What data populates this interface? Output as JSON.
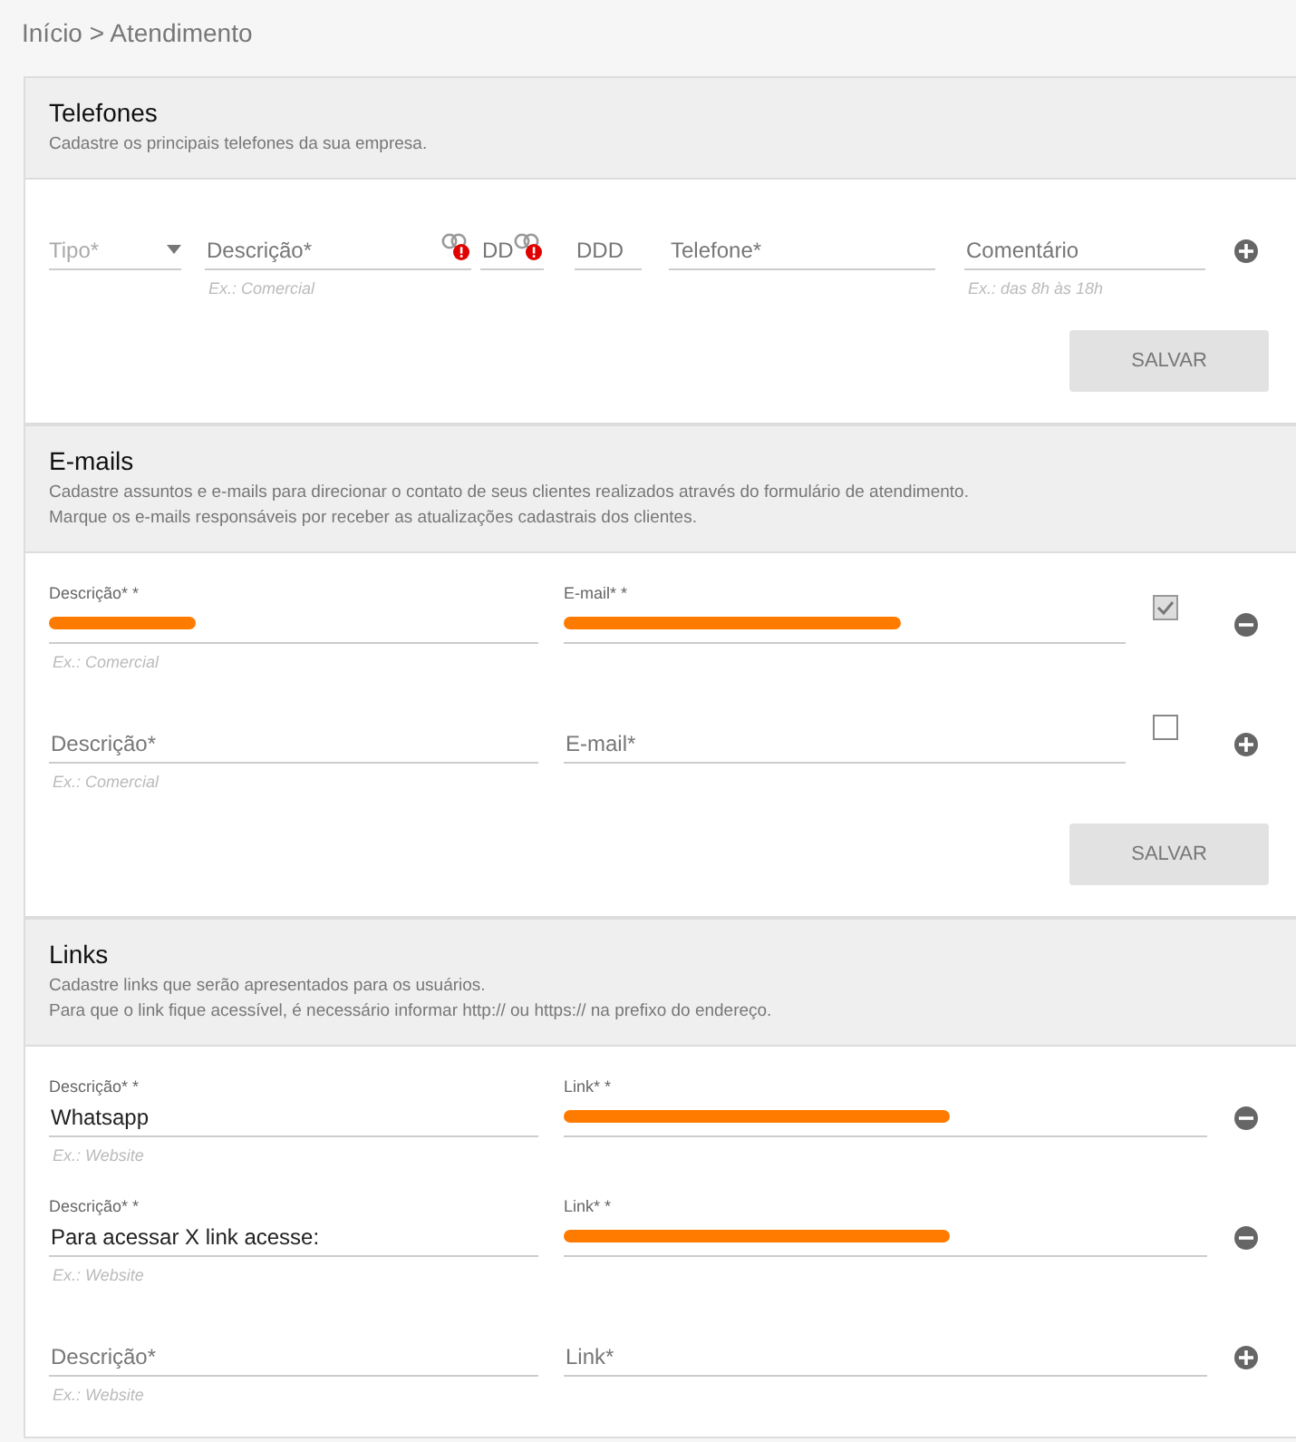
{
  "breadcrumb": "Início > Atendimento",
  "sections": [
    {
      "kind": "phones",
      "title": "Telefones",
      "description": [
        "Cadastre os principais telefones da sua empresa."
      ],
      "rows": [
        {
          "fields": [
            {
              "kind": "select",
              "placeholder": "Tipo*"
            },
            {
              "kind": "text",
              "placeholder": "Descrição*",
              "hint": "Ex.: Comercial",
              "warning": true
            },
            {
              "kind": "text",
              "placeholder": "DD",
              "warning": true
            },
            {
              "kind": "text",
              "placeholder": "DDD"
            },
            {
              "kind": "text",
              "placeholder": "Telefone*"
            },
            {
              "kind": "text",
              "placeholder": "Comentário",
              "hint": "Ex.: das 8h às 18h"
            }
          ],
          "removable": false
        }
      ],
      "save_button": "SALVAR"
    },
    {
      "kind": "emails",
      "title": "E-mails",
      "description": [
        "Cadastre assuntos e e-mails para direcionar o contato de seus clientes realizados através do formulário de atendimento.",
        "Marque os e-mails responsáveis por receber as atualizações cadastrais dos clientes."
      ],
      "rows": [
        {
          "fields": [
            {
              "kind": "text",
              "label": "Descrição* *",
              "redacted": true,
              "hint": "Ex.: Comercial"
            },
            {
              "kind": "text",
              "label": "E-mail* *",
              "redacted": true
            }
          ],
          "checkbox": {
            "checked": true
          },
          "removable": true
        },
        {
          "fields": [
            {
              "kind": "text",
              "placeholder": "Descrição*",
              "hint": "Ex.: Comercial"
            },
            {
              "kind": "text",
              "placeholder": "E-mail*"
            }
          ],
          "checkbox": {
            "checked": false
          },
          "removable": false
        }
      ],
      "save_button": "SALVAR"
    },
    {
      "kind": "links",
      "title": "Links",
      "description": [
        "Cadastre links que serão apresentados para os usuários.",
        "Para que o link fique acessível, é necessário informar http:// ou https:// na prefixo do endereço."
      ],
      "rows": [
        {
          "fields": [
            {
              "kind": "text",
              "label": "Descrição* *",
              "value": "Whatsapp",
              "hint": "Ex.: Website"
            },
            {
              "kind": "text",
              "label": "Link* *",
              "redacted": true
            }
          ],
          "removable": true
        },
        {
          "fields": [
            {
              "kind": "text",
              "label": "Descrição* *",
              "value": "Para acessar X link acesse:",
              "hint": "Ex.: Website"
            },
            {
              "kind": "text",
              "label": "Link* *",
              "redacted": true
            }
          ],
          "removable": true
        },
        {
          "fields": [
            {
              "kind": "text",
              "placeholder": "Descrição*",
              "hint": "Ex.: Website"
            },
            {
              "kind": "text",
              "placeholder": "Link*"
            }
          ],
          "removable": false
        }
      ]
    }
  ]
}
